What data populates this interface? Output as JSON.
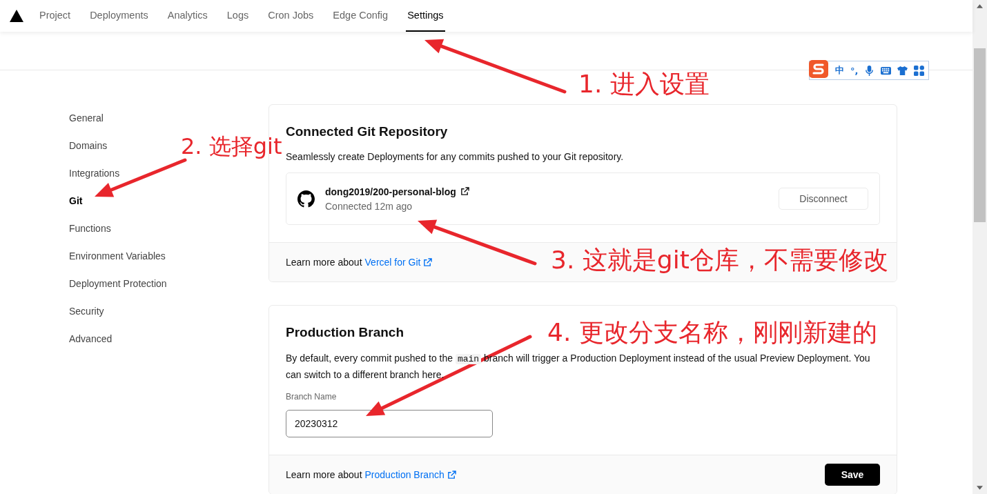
{
  "nav": {
    "tabs": [
      {
        "label": "Project",
        "selected": false
      },
      {
        "label": "Deployments",
        "selected": false
      },
      {
        "label": "Analytics",
        "selected": false
      },
      {
        "label": "Logs",
        "selected": false
      },
      {
        "label": "Cron Jobs",
        "selected": false
      },
      {
        "label": "Edge Config",
        "selected": false
      },
      {
        "label": "Settings",
        "selected": true
      }
    ]
  },
  "ime_toolbar": {
    "items": [
      "中",
      "°,"
    ]
  },
  "sidebar": {
    "items": [
      {
        "label": "General",
        "selected": false
      },
      {
        "label": "Domains",
        "selected": false
      },
      {
        "label": "Integrations",
        "selected": false
      },
      {
        "label": "Git",
        "selected": true
      },
      {
        "label": "Functions",
        "selected": false
      },
      {
        "label": "Environment Variables",
        "selected": false
      },
      {
        "label": "Deployment Protection",
        "selected": false
      },
      {
        "label": "Security",
        "selected": false
      },
      {
        "label": "Advanced",
        "selected": false
      }
    ]
  },
  "git_card": {
    "title": "Connected Git Repository",
    "description": "Seamlessly create Deployments for any commits pushed to your Git repository.",
    "repository": {
      "name": "dong2019/200-personal-blog",
      "status": "Connected 12m ago"
    },
    "disconnect_button": "Disconnect",
    "footer": {
      "text": "Learn more about",
      "link": "Vercel for Git"
    }
  },
  "branch_card": {
    "title": "Production Branch",
    "description_before": "By default, every commit pushed to the",
    "description_code": "main",
    "description_after": "branch will trigger a Production Deployment instead of the usual Preview Deployment. You can switch to a different branch here.",
    "field_label": "Branch Name",
    "field_value": "20230312",
    "footer": {
      "text": "Learn more about",
      "link": "Production Branch"
    },
    "save_button": "Save"
  },
  "annotations": [
    {
      "text": "1. 进入设置"
    },
    {
      "text": "2. 选择git"
    },
    {
      "text": "3. 这就是git仓库，不需要修改"
    },
    {
      "text": "4. 更改分支名称，刚刚新建的"
    }
  ]
}
